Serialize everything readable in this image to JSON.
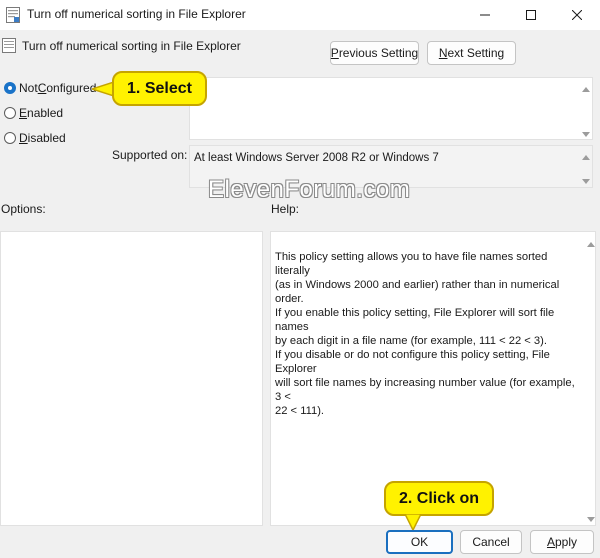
{
  "window": {
    "title": "Turn off numerical sorting in File Explorer",
    "controls": {
      "minimize": "minimize-icon",
      "maximize": "maximize-icon",
      "close": "close-icon"
    }
  },
  "header": {
    "setting_title": "Turn off numerical sorting in File Explorer",
    "previous_setting": {
      "pre": "",
      "mnemonic": "P",
      "post": "revious Setting"
    },
    "next_setting": {
      "pre": "",
      "mnemonic": "N",
      "post": "ext Setting"
    }
  },
  "state": {
    "options": [
      {
        "pre": "Not ",
        "mnemonic": "C",
        "post": "onfigured",
        "selected": true
      },
      {
        "pre": "",
        "mnemonic": "E",
        "post": "nabled",
        "selected": false
      },
      {
        "pre": "",
        "mnemonic": "D",
        "post": "isabled",
        "selected": false
      }
    ]
  },
  "comment": {
    "value": ""
  },
  "supported_on": {
    "label": "Supported on:",
    "value": "At least Windows Server 2008 R2 or Windows 7"
  },
  "sections": {
    "options_label": "Options:",
    "help_label": "Help:"
  },
  "help": {
    "lines": [
      "This policy setting allows you to have file names sorted literally",
      "(as in Windows 2000 and earlier) rather than in numerical order.",
      "If you enable this policy setting, File Explorer will sort file names",
      "by each digit in a file name (for example, 111 < 22 < 3).",
      "If you disable or do not configure this policy setting, File Explorer",
      "will sort file names by increasing number value (for example, 3 <",
      "22 < 111)."
    ]
  },
  "footer": {
    "ok": "OK",
    "cancel": {
      "pre": "",
      "mnemonic": "",
      "post": "Cancel"
    },
    "apply": {
      "pre": "",
      "mnemonic": "A",
      "post": "pply"
    }
  },
  "annotations": {
    "callout_select": "1. Select",
    "callout_click": "2. Click on",
    "watermark": "ElevenForum.com",
    "callout_color": "#fff200"
  },
  "colors": {
    "accent": "#1a73c8",
    "titlebar": "#ffffff",
    "dialog_bg": "#f0f0f0"
  }
}
